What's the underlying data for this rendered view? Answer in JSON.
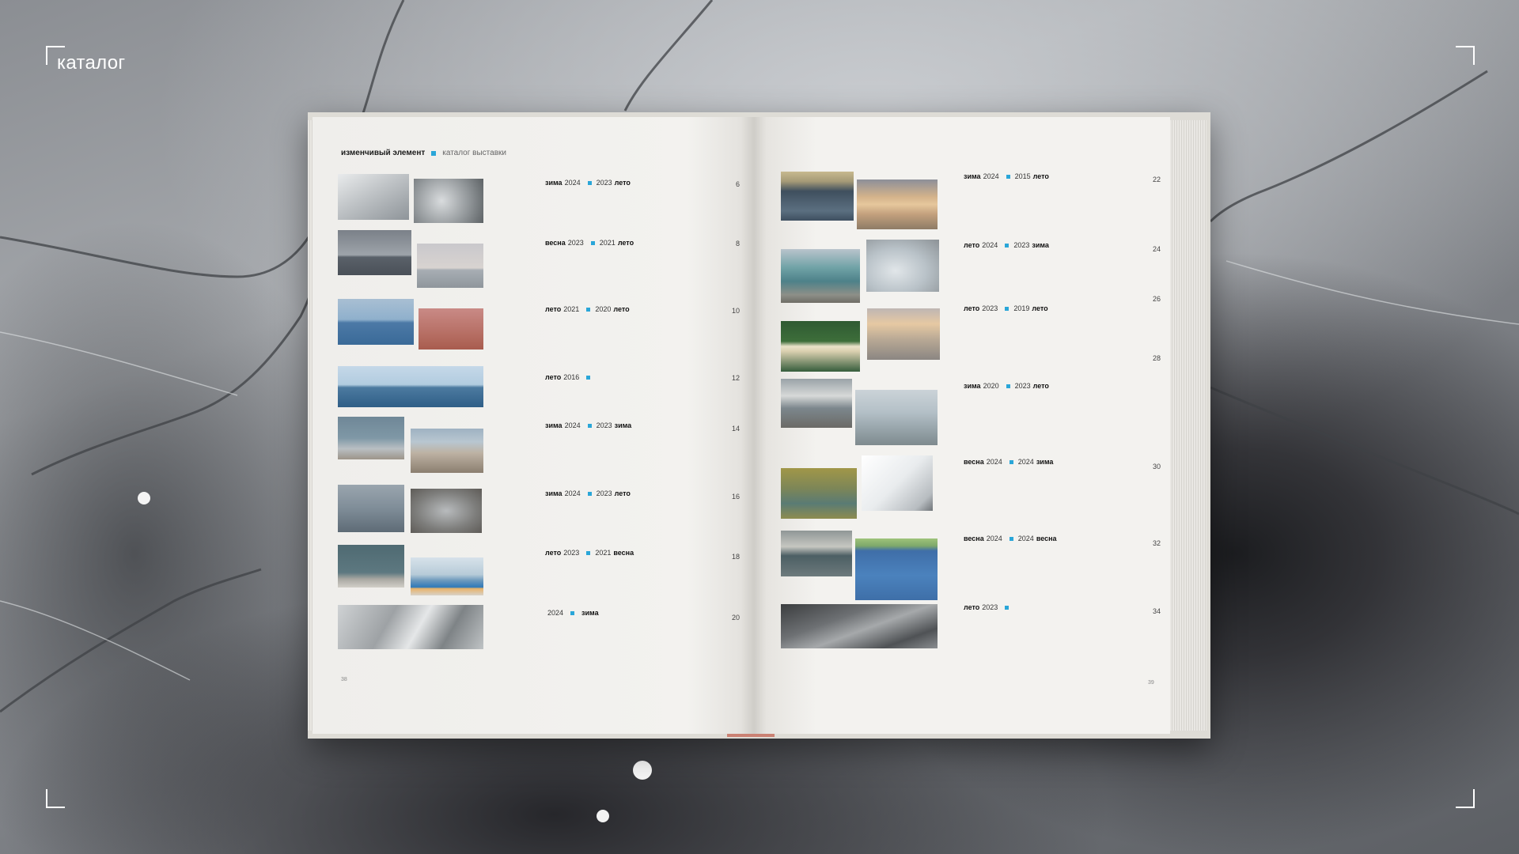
{
  "section_label": "каталог",
  "header": {
    "title": "изменчивый элемент",
    "subtitle": "каталог выставки"
  },
  "accent_color": "#2aa6d8",
  "left_entries": [
    {
      "season1": "зима",
      "year1": "2024",
      "year2": "2023",
      "season2": "лето",
      "page": "6"
    },
    {
      "season1": "весна",
      "year1": "2023",
      "year2": "2021",
      "season2": "лето",
      "page": "8"
    },
    {
      "season1": "лето",
      "year1": "2021",
      "year2": "2020",
      "season2": "лето",
      "page": "10"
    },
    {
      "season1": "лето",
      "year1": "2016",
      "year2": "",
      "season2": "",
      "page": "12"
    },
    {
      "season1": "зима",
      "year1": "2024",
      "year2": "2023",
      "season2": "зима",
      "page": "14"
    },
    {
      "season1": "зима",
      "year1": "2024",
      "year2": "2023",
      "season2": "лето",
      "page": "16"
    },
    {
      "season1": "лето",
      "year1": "2023",
      "year2": "2021",
      "season2": "весна",
      "page": "18"
    },
    {
      "season1": "",
      "year1": "2024",
      "year2": "",
      "season2": "зима",
      "page": "20"
    }
  ],
  "right_entries": [
    {
      "season1": "зима",
      "year1": "2024",
      "year2": "2015",
      "season2": "лето",
      "page": "22"
    },
    {
      "season1": "лето",
      "year1": "2024",
      "year2": "2023",
      "season2": "зима",
      "page": "24"
    },
    {
      "season1": "лето",
      "year1": "2023",
      "year2": "2019",
      "season2": "лето",
      "page": "26"
    },
    {
      "season1": "",
      "year1": "",
      "year2": "",
      "season2": "",
      "page": "28"
    },
    {
      "season1": "зима",
      "year1": "2020",
      "year2": "2023",
      "season2": "лето",
      "page": ""
    },
    {
      "season1": "весна",
      "year1": "2024",
      "year2": "2024",
      "season2": "зима",
      "page": "30"
    },
    {
      "season1": "весна",
      "year1": "2024",
      "year2": "2024",
      "season2": "весна",
      "page": "32"
    },
    {
      "season1": "лето",
      "year1": "2023",
      "year2": "",
      "season2": "",
      "page": "34"
    }
  ],
  "folios": {
    "left": "38",
    "right": "39"
  }
}
